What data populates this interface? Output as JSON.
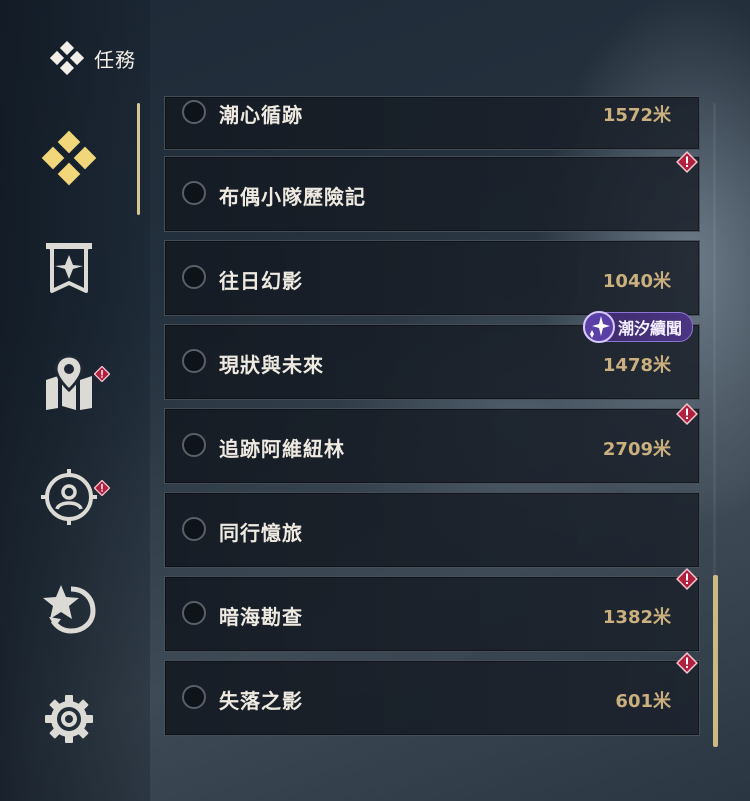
{
  "header": {
    "title": "任務"
  },
  "sidebar": {
    "items": [
      {
        "name": "quests",
        "icon": "diamond-cluster-icon",
        "active": true,
        "alert": false
      },
      {
        "name": "banner",
        "icon": "banner-star-icon",
        "active": false,
        "alert": false
      },
      {
        "name": "map",
        "icon": "map-pin-icon",
        "active": false,
        "alert": true
      },
      {
        "name": "character",
        "icon": "person-target-icon",
        "active": false,
        "alert": true
      },
      {
        "name": "achievements",
        "icon": "star-refresh-icon",
        "active": false,
        "alert": false
      },
      {
        "name": "settings",
        "icon": "gear-icon",
        "active": false,
        "alert": false
      }
    ]
  },
  "quests": [
    {
      "name": "潮心循跡",
      "distance": "1572米",
      "alert": false
    },
    {
      "name": "布偶小隊歷險記",
      "distance": "",
      "alert": true
    },
    {
      "name": "往日幻影",
      "distance": "1040米",
      "alert": false
    },
    {
      "name": "現狀與未來",
      "distance": "1478米",
      "alert": false,
      "tag": "潮汐續聞"
    },
    {
      "name": "追跡阿維紐林",
      "distance": "2709米",
      "alert": true
    },
    {
      "name": "同行憶旅",
      "distance": "",
      "alert": false
    },
    {
      "name": "暗海勘查",
      "distance": "1382米",
      "alert": true
    },
    {
      "name": "失落之影",
      "distance": "601米",
      "alert": true
    }
  ],
  "colors": {
    "accent": "#f1d77a",
    "distance": "#c9b07e",
    "alert": "#b0203f",
    "tag": "#4b3584"
  }
}
